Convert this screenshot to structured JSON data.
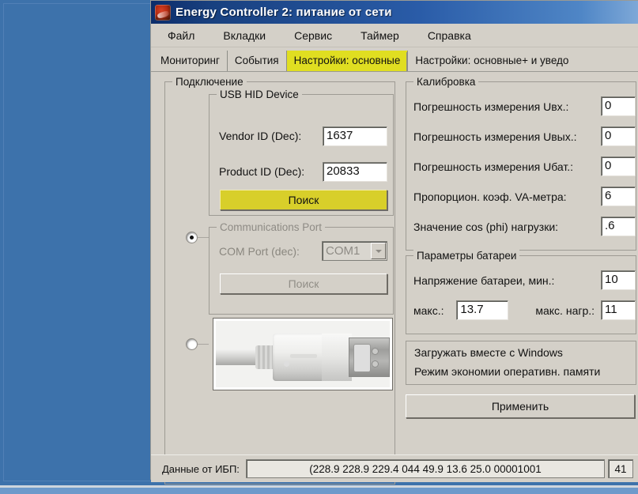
{
  "window": {
    "title": "Energy Controller 2: питание от сети",
    "icon": "app-logo-icon"
  },
  "menu": {
    "items": [
      {
        "label": "Файл"
      },
      {
        "label": "Вкладки"
      },
      {
        "label": "Сервис"
      },
      {
        "label": "Таймер"
      },
      {
        "label": "Справка"
      }
    ]
  },
  "tabs": [
    {
      "label": "Мониторинг",
      "active": false
    },
    {
      "label": "События",
      "active": false
    },
    {
      "label": "Настройки:  основные",
      "active": true
    },
    {
      "label": "Настройки: основные+ и уведо",
      "active": false
    }
  ],
  "connection": {
    "legend": "Подключение",
    "usb": {
      "legend": "USB HID Device",
      "vendor_label": "Vendor ID (Dec):",
      "vendor_value": "1637",
      "product_label": "Product ID (Dec):",
      "product_value": "20833",
      "search_label": "Поиск"
    },
    "com": {
      "legend": "Communications Port",
      "port_label": "COM Port (dec):",
      "port_value": "COM1",
      "search_label": "Поиск"
    }
  },
  "calibration": {
    "legend": "Калибровка",
    "rows": [
      {
        "label": "Погрешность  измерения   Uвх.:",
        "value": "0"
      },
      {
        "label": "Погрешность  измерения Uвых.:",
        "value": "0"
      },
      {
        "label": "Погрешность  измерения  Uбат.:",
        "value": "0"
      },
      {
        "label": "Пропорцион.   коэф.  VA-метра:",
        "value": "6"
      },
      {
        "label": "Значение     cos (phi)    нагрузки:",
        "value": ".6"
      }
    ]
  },
  "battery": {
    "legend": "Параметры батареи",
    "row1_label": "Напряжение      батареи,      мин.:",
    "row1_value": "10",
    "row2_label_a": "макс.:",
    "row2_value_a": "13.7",
    "row2_label_b": "макс.   нагр.:",
    "row2_value_b": "11"
  },
  "options": {
    "line1": "Загружать    вместе    с    Windows",
    "line2": "Режим экономии оперативн. памяти"
  },
  "apply": {
    "label": "Применить"
  },
  "status": {
    "label": "Данные от  ИБП:",
    "value": "(228.9 228.9 229.4 044 49.9 13.6 25.0 00001001",
    "count": "41"
  },
  "colors": {
    "desktop": "#3d72ab",
    "window_face": "#d4d0c8",
    "title_bar_start": "#0c2d6b",
    "active_tab": "#e0de21",
    "search_button": "#d8cf2a"
  }
}
